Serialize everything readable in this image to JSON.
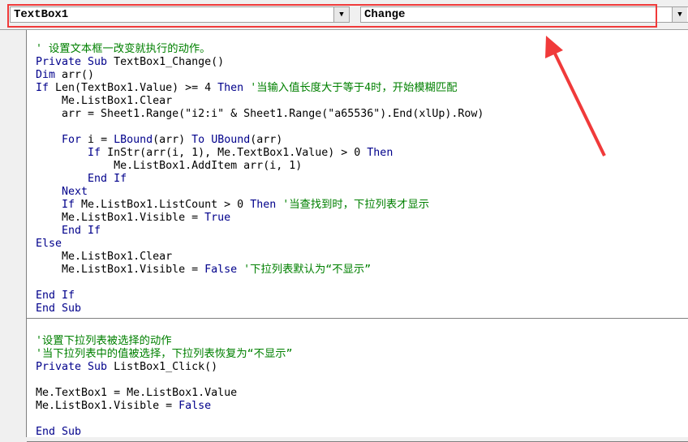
{
  "object_combo": {
    "value": "TextBox1"
  },
  "procedure_combo": {
    "value": "Change"
  },
  "dropdown_icon": "▼",
  "colors": {
    "keyword": "#00008b",
    "comment": "#008000",
    "highlight": "#f03a3a"
  },
  "procedures": [
    {
      "lines": [
        [],
        [
          [
            "cm",
            "' 设置文本框一改变就执行的动作。"
          ]
        ],
        [
          [
            "kw",
            "Private Sub"
          ],
          [
            "t",
            " TextBox1_Change()"
          ]
        ],
        [
          [
            "kw",
            "Dim"
          ],
          [
            "t",
            " arr()"
          ]
        ],
        [
          [
            "kw",
            "If"
          ],
          [
            "t",
            " Len(TextBox1.Value) >= 4 "
          ],
          [
            "kw",
            "Then"
          ],
          [
            "cm",
            " '当输入值长度大于等于4时，开始模糊匹配"
          ]
        ],
        [
          [
            "t",
            "    Me.ListBox1.Clear"
          ]
        ],
        [
          [
            "t",
            "    arr = Sheet1.Range(\"i2:i\" & Sheet1.Range(\"a65536\").End(xlUp).Row)"
          ]
        ],
        [],
        [
          [
            "kw",
            "    For"
          ],
          [
            "t",
            " i = "
          ],
          [
            "kw",
            "LBound"
          ],
          [
            "t",
            "(arr) "
          ],
          [
            "kw",
            "To"
          ],
          [
            "t",
            " "
          ],
          [
            "kw",
            "UBound"
          ],
          [
            "t",
            "(arr)"
          ]
        ],
        [
          [
            "kw",
            "        If"
          ],
          [
            "t",
            " InStr(arr(i, 1), Me.TextBox1.Value) > 0 "
          ],
          [
            "kw",
            "Then"
          ]
        ],
        [
          [
            "t",
            "            Me.ListBox1.AddItem arr(i, 1)"
          ]
        ],
        [
          [
            "kw",
            "        End If"
          ]
        ],
        [
          [
            "kw",
            "    Next"
          ]
        ],
        [
          [
            "kw",
            "    If"
          ],
          [
            "t",
            " Me.ListBox1.ListCount > 0 "
          ],
          [
            "kw",
            "Then"
          ],
          [
            "cm",
            " '当查找到时，下拉列表才显示"
          ]
        ],
        [
          [
            "t",
            "    Me.ListBox1.Visible = "
          ],
          [
            "kw",
            "True"
          ]
        ],
        [
          [
            "kw",
            "    End If"
          ]
        ],
        [
          [
            "kw",
            "Else"
          ]
        ],
        [
          [
            "t",
            "    Me.ListBox1.Clear"
          ]
        ],
        [
          [
            "t",
            "    Me.ListBox1.Visible = "
          ],
          [
            "kw",
            "False"
          ],
          [
            "cm",
            " '下拉列表默认为“不显示”"
          ]
        ],
        [],
        [
          [
            "kw",
            "End If"
          ]
        ],
        [
          [
            "kw",
            "End Sub"
          ]
        ]
      ]
    },
    {
      "lines": [
        [],
        [
          [
            "cm",
            "'设置下拉列表被选择的动作"
          ]
        ],
        [
          [
            "cm",
            "'当下拉列表中的值被选择，下拉列表恢复为“不显示”"
          ]
        ],
        [
          [
            "kw",
            "Private Sub"
          ],
          [
            "t",
            " ListBox1_Click()"
          ]
        ],
        [],
        [
          [
            "t",
            "Me.TextBox1 = Me.ListBox1.Value"
          ]
        ],
        [
          [
            "t",
            "Me.ListBox1.Visible = "
          ],
          [
            "kw",
            "False"
          ]
        ],
        [],
        [
          [
            "kw",
            "End Sub"
          ]
        ]
      ]
    }
  ]
}
